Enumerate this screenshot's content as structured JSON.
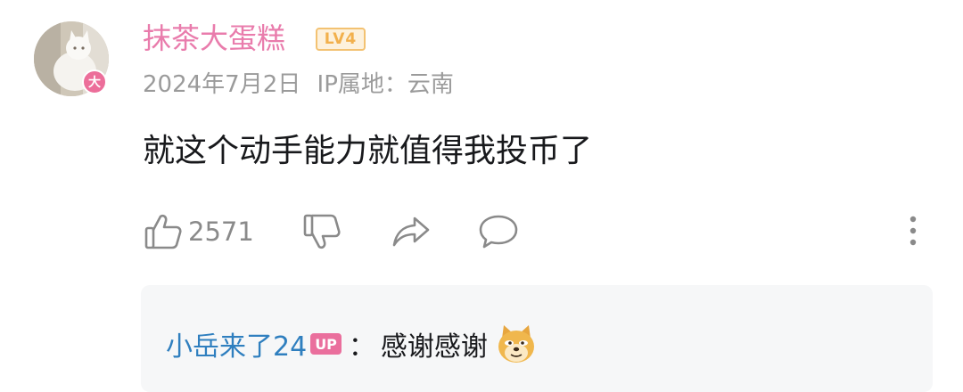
{
  "comment": {
    "username": "抹茶大蛋糕",
    "level_badge": "LV4",
    "avatar_badge": "大",
    "date": "2024年7月2日",
    "ip_location": "IP属地：云南",
    "text": "就这个动手能力就值得我投币了",
    "actions": {
      "like_icon": "thumbs-up-icon",
      "like_count": "2571",
      "dislike_icon": "thumbs-down-icon",
      "share_icon": "share-icon",
      "comment_icon": "comment-icon",
      "more_icon": "more-vertical-icon"
    }
  },
  "reply": {
    "username": "小岳来了24",
    "badge": "UP",
    "colon": "：",
    "text": "感谢感谢",
    "emoji": "doge-emoji"
  },
  "colors": {
    "username": "#e97cac",
    "reply_username": "#2f7fbf",
    "level_badge": "#f2b04c",
    "up_badge": "#ea6f9d",
    "meta_text": "#9b9b9b",
    "reply_background": "#f6f7f8"
  }
}
